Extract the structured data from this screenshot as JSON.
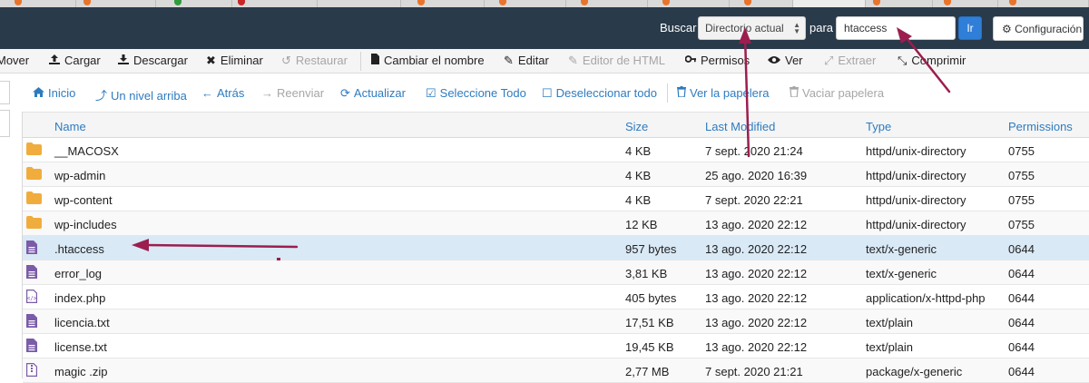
{
  "header": {
    "search_label": "Buscar",
    "scope_select": "Directorio actual",
    "for_label": "para",
    "search_value": "htaccess",
    "go_label": "Ir",
    "settings_label": "Configuración"
  },
  "toolbar": {
    "move": "Mover",
    "upload": "Cargar",
    "download": "Descargar",
    "delete": "Eliminar",
    "restore": "Restaurar",
    "rename": "Cambiar el nombre",
    "edit": "Editar",
    "html_editor": "Editor de HTML",
    "permissions": "Permisos",
    "view": "Ver",
    "extract": "Extraer",
    "compress": "Comprimir"
  },
  "nav": {
    "home": "Inicio",
    "up_one_level": "Un nivel arriba",
    "back": "Atrás",
    "forward": "Reenviar",
    "reload": "Actualizar",
    "select_all": "Seleccione Todo",
    "unselect_all": "Deseleccionar todo",
    "view_trash": "Ver la papelera",
    "empty_trash": "Vaciar papelera"
  },
  "table": {
    "columns": {
      "name": "Name",
      "size": "Size",
      "modified": "Last Modified",
      "type": "Type",
      "perms": "Permissions"
    },
    "rows": [
      {
        "name": "__MACOSX",
        "size": "4 KB",
        "modified": "7 sept. 2020 21:24",
        "type": "httpd/unix-directory",
        "perms": "0755",
        "icon": "folder-icon"
      },
      {
        "name": "wp-admin",
        "size": "4 KB",
        "modified": "25 ago. 2020 16:39",
        "type": "httpd/unix-directory",
        "perms": "0755",
        "icon": "folder-icon"
      },
      {
        "name": "wp-content",
        "size": "4 KB",
        "modified": "7 sept. 2020 22:21",
        "type": "httpd/unix-directory",
        "perms": "0755",
        "icon": "folder-icon"
      },
      {
        "name": "wp-includes",
        "size": "12 KB",
        "modified": "13 ago. 2020 22:12",
        "type": "httpd/unix-directory",
        "perms": "0755",
        "icon": "folder-icon"
      },
      {
        "name": ".htaccess",
        "size": "957 bytes",
        "modified": "13 ago. 2020 22:12",
        "type": "text/x-generic",
        "perms": "0644",
        "icon": "text-file-icon"
      },
      {
        "name": "error_log",
        "size": "3,81 KB",
        "modified": "13 ago. 2020 22:12",
        "type": "text/x-generic",
        "perms": "0644",
        "icon": "text-file-icon"
      },
      {
        "name": "index.php",
        "size": "405 bytes",
        "modified": "13 ago. 2020 22:12",
        "type": "application/x-httpd-php",
        "perms": "0644",
        "icon": "code-file-icon"
      },
      {
        "name": "licencia.txt",
        "size": "17,51 KB",
        "modified": "13 ago. 2020 22:12",
        "type": "text/plain",
        "perms": "0644",
        "icon": "text-file-icon"
      },
      {
        "name": "license.txt",
        "size": "19,45 KB",
        "modified": "13 ago. 2020 22:12",
        "type": "text/plain",
        "perms": "0644",
        "icon": "text-file-icon"
      },
      {
        "name": "magic .zip",
        "size": "2,77 MB",
        "modified": "7 sept. 2020 21:21",
        "type": "package/x-generic",
        "perms": "0644",
        "icon": "zip-file-icon"
      }
    ]
  },
  "colors": {
    "header_bg": "#293a4a",
    "link_blue": "#2f7bbf",
    "selected_row": "#d9e9f6",
    "folder": "#f0ad3d",
    "file_icon": "#7a5ca8",
    "annotation_arrow": "#9b1e4e"
  }
}
